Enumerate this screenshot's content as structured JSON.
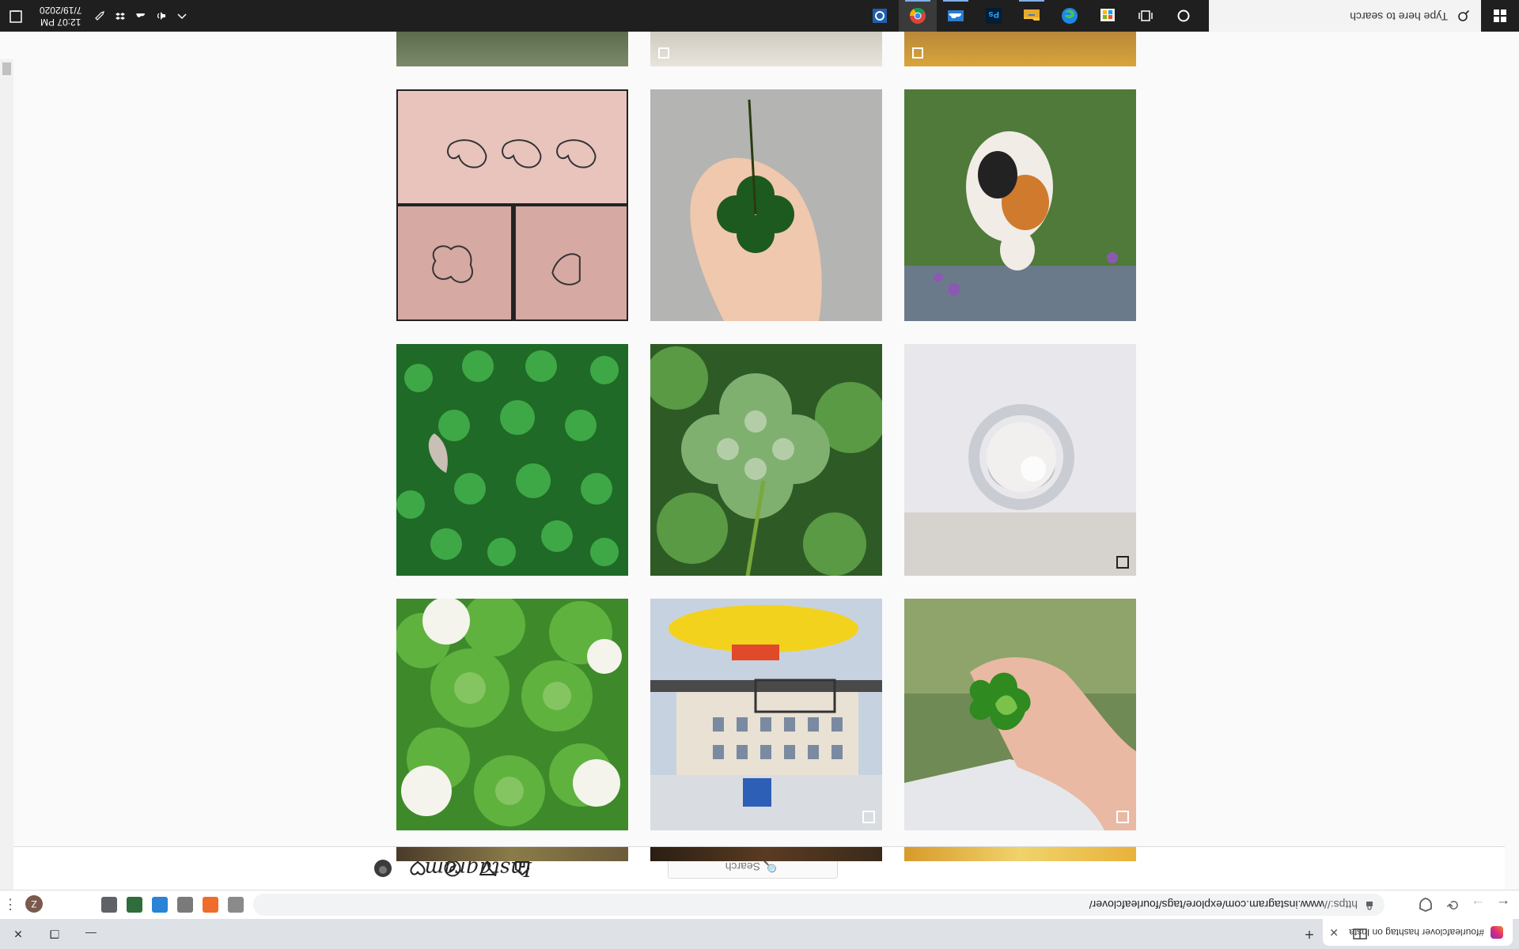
{
  "browser": {
    "tab_title": "#fourleafclover hashtag on Insta",
    "tab_close": "✕",
    "new_tab": "+",
    "url_scheme": "https://",
    "url_rest": "www.instagram.com/explore/tags/fourleafclover/",
    "profile_initial": "Z",
    "back": "←",
    "forward": "→",
    "reload": "⟳",
    "menu": "⋮",
    "minimize": "—",
    "maximize": "❐",
    "close": "✕",
    "extensions": [
      {
        "name": "ext-gray",
        "color": "#8a8a8a"
      },
      {
        "name": "ext-orange",
        "color": "#ef6c2c"
      },
      {
        "name": "ext-circle",
        "color": "#7a7a7a"
      },
      {
        "name": "ext-blue",
        "color": "#2a83d6"
      },
      {
        "name": "ext-dollar",
        "color": "#2f6d3a"
      },
      {
        "name": "ext-puzzle",
        "color": "#5f6368"
      }
    ]
  },
  "instagram": {
    "logo": "Instagram",
    "search_placeholder": "🔍 Search",
    "nav_icons": [
      "home-icon",
      "direct-icon",
      "explore-icon",
      "activity-icon",
      "profile-avatar"
    ],
    "tiles": [
      {
        "name": "post-tattoo-elephants",
        "multi": false
      },
      {
        "name": "post-hand-clover",
        "multi": false
      },
      {
        "name": "post-calico-cat",
        "multi": false
      },
      {
        "name": "post-clover-patch",
        "multi": false
      },
      {
        "name": "post-clover-closeup",
        "multi": false
      },
      {
        "name": "post-pearl-ring",
        "multi": true
      },
      {
        "name": "post-white-clover-flowers",
        "multi": false
      },
      {
        "name": "post-yellow-submarine",
        "multi": true
      },
      {
        "name": "post-hand-holding-clover",
        "multi": true
      }
    ]
  },
  "taskbar": {
    "search_placeholder": "Type here to search",
    "time": "12:07 PM",
    "date": "7/19/2020",
    "apps": [
      "cortana-icon",
      "task-view-icon",
      "store-icon",
      "edge-icon",
      "file-explorer-icon",
      "photoshop-icon",
      "onedrive-icon",
      "chrome-icon",
      "settings-icon"
    ]
  }
}
